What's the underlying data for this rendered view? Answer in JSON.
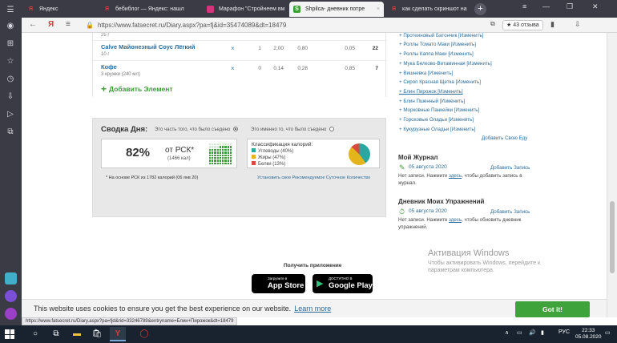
{
  "browser": {
    "tabs": [
      {
        "label": "Яндекс",
        "favicon": "Я",
        "favicon_color": "#e03a3a"
      },
      {
        "label": "бебиблог — Яндекс: нашл",
        "favicon": "Я",
        "favicon_color": "#e03a3a"
      },
      {
        "label": "Марафон \"Стройнеем вм",
        "favicon": "",
        "favicon_color": "#d6337a"
      },
      {
        "label": "Shpilca- дневник потре",
        "favicon": "S",
        "favicon_color": "#3f9a39"
      },
      {
        "label": "как сделать скриншот на",
        "favicon": "Я",
        "favicon_color": "#e03a3a"
      }
    ],
    "new_tab_symbol": "+",
    "url": "https://www.fatsecret.ru/Diary.aspx?pa=fj&id=35474089&dt=18479",
    "reviews": "43 отзыва",
    "reviews_star": "★"
  },
  "food": {
    "partial_sub": "25 г",
    "rows": [
      {
        "name": "Calve Майонезный Соус Лёгкий",
        "sub": "10 г",
        "x": "×",
        "v1": "1",
        "v2": "2,00",
        "v3": "0,80",
        "v4": "0,05",
        "v5": "22"
      },
      {
        "name": "Кофе",
        "sub": "3 кружки (240 мл)",
        "x": "×",
        "v1": "0",
        "v2": "0,14",
        "v3": "0,28",
        "v4": "0,85",
        "v5": "7"
      }
    ],
    "add_label": "Добавить Элемент",
    "add_symbol": "+"
  },
  "summary": {
    "title": "Сводка Дня:",
    "option_eaten": "Это часть того, что было съедено",
    "option_remaining": "Это именно то, что было съедено",
    "rsk_pct": "82%",
    "rsk_of": "от РСК*",
    "rsk_kcal": "(1466 кал)",
    "rsk_fraction": 0.82,
    "classification_title": "Классификация калорий:",
    "classes": [
      {
        "label": "Углеводы (40%)",
        "color": "#2aa7a1",
        "pct": 40
      },
      {
        "label": "Жиры (47%)",
        "color": "#e4b51a",
        "pct": 47
      },
      {
        "label": "Белки (13%)",
        "color": "#d64b3c",
        "pct": 13
      }
    ],
    "note": "* На основе РСК из 1782 калорий (06 янв 20)",
    "set_link": "Установить свое Рекомендуемое Суточное Количество"
  },
  "app": {
    "title": "Получить приложение",
    "appstore_small": "Загрузите в",
    "appstore_big": "App Store",
    "googleplay_small": "ДОСТУПНО В",
    "googleplay_big": "Google Play"
  },
  "right": {
    "links": [
      "+ Протеиновый Батончик [Изменить]",
      "+ Роллы Томато Маки [Изменить]",
      "+ Роллы Каппа Маки [Изменить]",
      "+ Мука Белково-Витаминная [Изменить]",
      "+ Вишневка [Изменить]",
      "+ Сироп Красная Щетка [Изменить]",
      "+ Блин Пирожок [Изменить]",
      "+ Блин Пшенный [Изменить]",
      "+ Морковные Панкейки [Изменить]",
      "+ Гороховые Оладьи [Изменить]",
      "+ Кукурузные Оладьи [Изменить]"
    ],
    "add_own": "Добавить Свою Еду",
    "journal_title": "Мой Журнал",
    "journal_date": "05 августа 2020",
    "journal_add": "Добавить Запись",
    "journal_text_before": "Нет записи. Нажмите ",
    "journal_link": "здесь",
    "journal_text_after": ", чтобы добавить запись в журнал.",
    "exercise_title": "Дневник Моих Упражнений",
    "exercise_date": "05 августа 2020",
    "exercise_add": "Добавить Запись",
    "exercise_text_before": "Нет записи. Нажмите ",
    "exercise_link": "здесь",
    "exercise_text_after": ", чтобы обновить дневник упражнений."
  },
  "cookie": {
    "text": "This website uses cookies to ensure you get the best experience on our website.",
    "link": "Learn more",
    "button": "Got it!"
  },
  "watermark": {
    "title": "Активация Windows",
    "line1": "Чтобы активировать Windows, перейдите к",
    "line2": "параметрам компьютера."
  },
  "status_url": "https://www.fatsecret.ru/Diary.aspx?pa=fjd&rid=33246789&entryname=Блин+Пирожок&dt=18479",
  "taskbar": {
    "lang": "РУС",
    "time": "22:33",
    "date": "05.08.2020"
  }
}
